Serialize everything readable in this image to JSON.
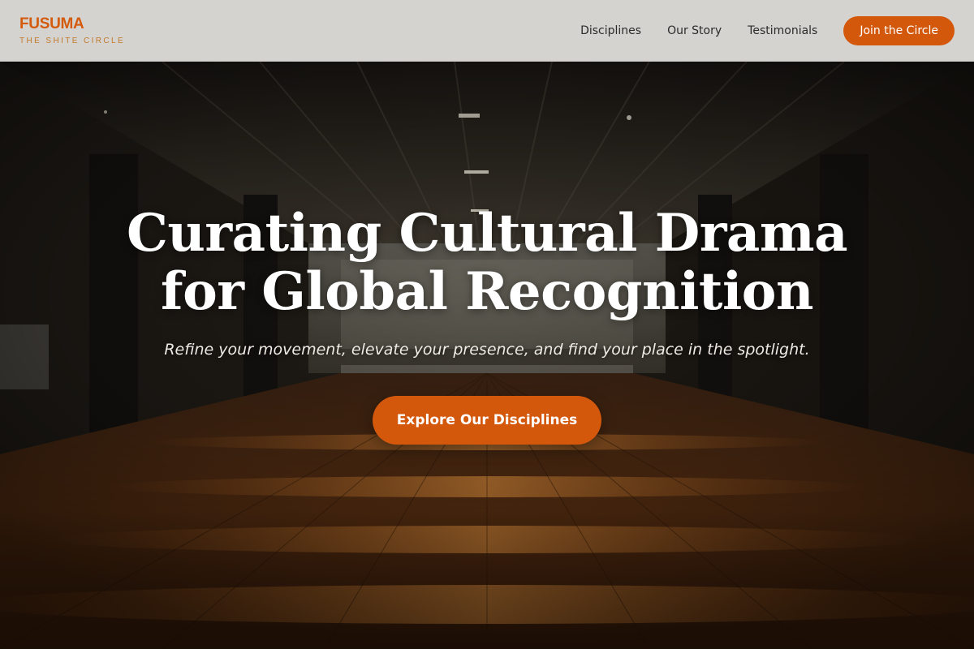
{
  "header": {
    "brand_name": "FUSUMA",
    "brand_tagline": "THE SHITE CIRCLE",
    "nav": [
      {
        "label": "Disciplines"
      },
      {
        "label": "Our Story"
      },
      {
        "label": "Testimonials"
      }
    ],
    "cta_label": "Join the Circle"
  },
  "hero": {
    "title_line1": "Curating Cultural Drama",
    "title_line2": "for Global Recognition",
    "subtitle": "Refine your movement, elevate your presence, and find your place in the spotlight.",
    "cta_label": "Explore Our Disciplines",
    "background_image": "dark-hall-wooden-floor-photo"
  },
  "colors": {
    "accent": "#d4580c",
    "brand": "#d45a0c",
    "tagline": "#c27a2a",
    "header_bg": "#dedcd9",
    "nav_text": "#2b2b2b"
  }
}
